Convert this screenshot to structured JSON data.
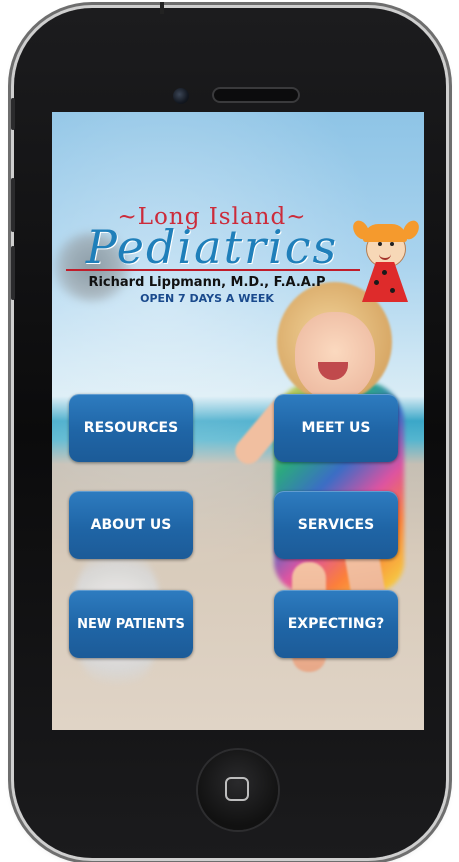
{
  "device": {
    "type": "phone"
  },
  "logo": {
    "line1": "~Long Island~",
    "line2": "Pediatrics",
    "doctor": "Richard Lippmann, M.D., F.A.A.P",
    "hours": "OPEN 7 DAYS A WEEK"
  },
  "menu": {
    "resources": "RESOURCES",
    "meet_us": "MEET US",
    "about_us": "ABOUT US",
    "services": "SERVICES",
    "new_patients": "NEW PATIENTS",
    "expecting": "EXPECTING?"
  },
  "icons": {
    "home": "home-square-icon",
    "camera": "camera-icon",
    "speaker": "speaker-icon"
  },
  "colors": {
    "button": "#1f65a6",
    "logo_red": "#cc2b3a",
    "logo_blue": "#1f7fba"
  }
}
